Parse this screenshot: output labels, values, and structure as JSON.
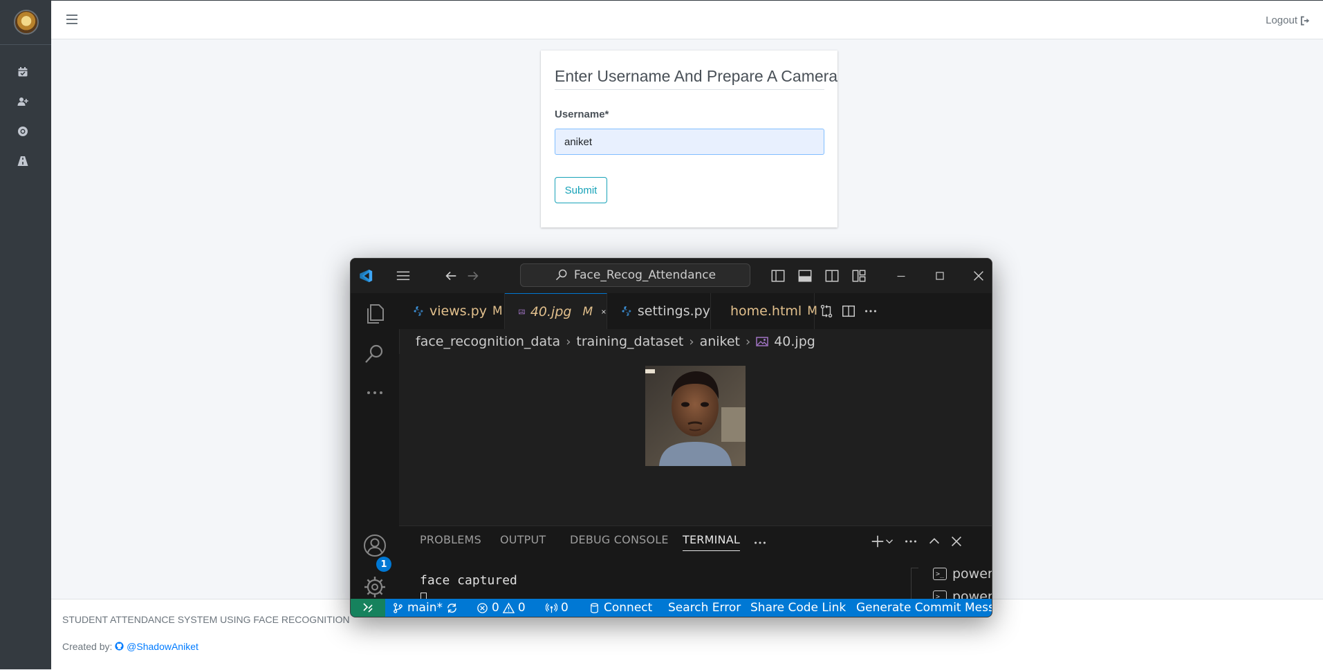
{
  "nav": {
    "logout_label": "Logout"
  },
  "form": {
    "title": "Enter Username And Prepare A Camera",
    "username_label": "Username*",
    "username_value": "aniket",
    "submit_label": "Submit"
  },
  "footer": {
    "system_name": "STUDENT ATTENDANCE SYSTEM USING FACE RECOGNITION",
    "created_by_label": "Created by:",
    "author_link": "@ShadowAniket"
  },
  "vscode": {
    "search_text": "Face_Recog_Attendance",
    "tabs": [
      {
        "label": "views.py",
        "modified": "M",
        "color": "#e2c08d"
      },
      {
        "label": "40.jpg",
        "modified": "M",
        "color": "#e2c08d"
      },
      {
        "label": "settings.py",
        "modified": "",
        "color": "#cccccc"
      },
      {
        "label": "home.html",
        "modified": "M",
        "color": "#e2c08d"
      }
    ],
    "breadcrumb": [
      "face_recognition_data",
      "training_dataset",
      "aniket",
      "40.jpg"
    ],
    "accounts_badge": "1",
    "panel_tabs": [
      "PROBLEMS",
      "OUTPUT",
      "DEBUG CONSOLE",
      "TERMINAL"
    ],
    "active_panel_tab": "TERMINAL",
    "terminal_output": "face captured",
    "shells": [
      "powershell",
      "powershell"
    ],
    "status": {
      "branch": "main*",
      "errors": "0",
      "warnings": "0",
      "ports": "0",
      "connect": "Connect",
      "search_error": "Search Error",
      "share_code_link": "Share Code Link",
      "generate_commit": "Generate Commit Messa"
    },
    "colors": {
      "accent": "#0078d4",
      "remote": "#16825d",
      "modified": "#e2c08d"
    }
  }
}
